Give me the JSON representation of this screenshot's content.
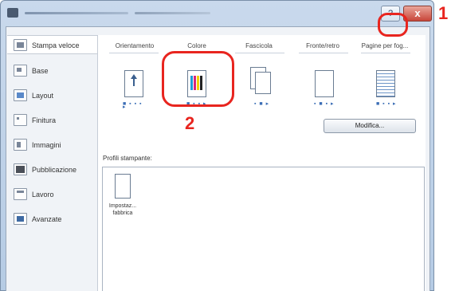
{
  "window": {
    "close_glyph": "x",
    "help_glyph": "?"
  },
  "sidebar": {
    "items": [
      {
        "label": "Stampa veloce",
        "icon": "quick-print-icon"
      },
      {
        "label": "Base",
        "icon": "basic-icon"
      },
      {
        "label": "Layout",
        "icon": "layout-icon"
      },
      {
        "label": "Finitura",
        "icon": "finishing-icon"
      },
      {
        "label": "Immagini",
        "icon": "imaging-icon"
      },
      {
        "label": "Pubblicazione",
        "icon": "publishing-icon"
      },
      {
        "label": "Lavoro",
        "icon": "job-icon"
      },
      {
        "label": "Avanzate",
        "icon": "advanced-icon"
      }
    ]
  },
  "main": {
    "columns": [
      {
        "label": "Orientamento",
        "icon": "portrait-orientation-icon",
        "dots": "■ ▪ ▪ ▪ ▸"
      },
      {
        "label": "Colore",
        "icon": "color-icon",
        "dots": "■ ▪ ▪ ▸"
      },
      {
        "label": "Fascicola",
        "icon": "collate-icon",
        "dots": "▪ ■ ▸"
      },
      {
        "label": "Fronte/retro",
        "icon": "duplex-icon",
        "dots": "▪ ■ ▪ ▸"
      },
      {
        "label": "Pagine per fog...",
        "icon": "pages-per-sheet-icon",
        "dots": "■ ▪ ▪ ▸"
      }
    ],
    "modify_button": "Modifica...",
    "profiles_label": "Profili stampante:",
    "profiles": [
      {
        "name_line1": "Impostaz...",
        "name_line2": "fabbrica"
      }
    ]
  },
  "annotations": {
    "callout_1": "1",
    "callout_2": "2",
    "accent_color": "#e8251f"
  }
}
